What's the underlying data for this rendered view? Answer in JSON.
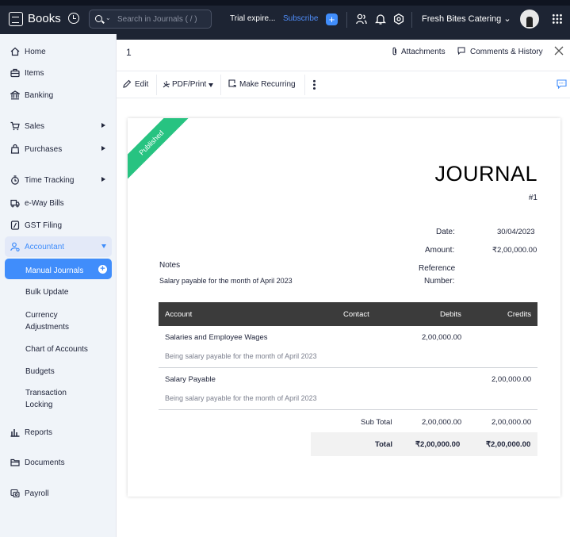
{
  "app": {
    "name": "Books",
    "search_placeholder": "Search in Journals ( / )",
    "trial_text": "Trial expire...",
    "subscribe_label": "Subscribe",
    "org_name": "Fresh Bites Catering",
    "accent": "#408dfb",
    "topbar_color": "#1d2433"
  },
  "sidebar": {
    "items": [
      {
        "label": "Home",
        "icon": "home-icon"
      },
      {
        "label": "Items",
        "icon": "items-icon"
      },
      {
        "label": "Banking",
        "icon": "bank-icon"
      },
      {
        "label": "Sales",
        "icon": "cart-icon"
      },
      {
        "label": "Purchases",
        "icon": "bag-icon"
      },
      {
        "label": "Time Tracking",
        "icon": "timer-icon"
      },
      {
        "label": "e-Way Bills",
        "icon": "truck-icon"
      },
      {
        "label": "GST Filing",
        "icon": "gst-icon"
      },
      {
        "label": "Accountant",
        "icon": "accountant-icon"
      },
      {
        "label": "Reports",
        "icon": "reports-icon"
      },
      {
        "label": "Documents",
        "icon": "folder-icon"
      },
      {
        "label": "Payroll",
        "icon": "payroll-icon"
      }
    ],
    "accountant_sub": [
      {
        "label": "Manual Journals"
      },
      {
        "label": "Bulk Update"
      },
      {
        "label": "Currency Adjustments"
      },
      {
        "label": "Chart of Accounts"
      },
      {
        "label": "Budgets"
      },
      {
        "label": "Transaction Locking"
      }
    ]
  },
  "header": {
    "doc_number": "1",
    "attachments_label": "Attachments",
    "comments_label": "Comments & History"
  },
  "toolbar": {
    "edit_label": "Edit",
    "pdf_label": "PDF/Print",
    "recurring_label": "Make Recurring"
  },
  "journal": {
    "ribbon": "Published",
    "title": "JOURNAL",
    "number": "#1",
    "date_label": "Date:",
    "date_value": "30/04/2023",
    "amount_label": "Amount:",
    "amount_value": "₹2,00,000.00",
    "ref_label_1": "Reference",
    "ref_label_2": "Number:",
    "notes_label": "Notes",
    "notes_text": "Salary payable for the month of April 2023",
    "columns": [
      "Account",
      "Contact",
      "Debits",
      "Credits"
    ],
    "rows": [
      {
        "account": "Salaries and Employee Wages",
        "description": "Being salary payable for the month of April 2023",
        "debit": "2,00,000.00",
        "credit": ""
      },
      {
        "account": "Salary Payable",
        "description": "Being salary payable for the month of April 2023",
        "debit": "",
        "credit": "2,00,000.00"
      }
    ],
    "subtotal_label": "Sub Total",
    "subtotal_debit": "2,00,000.00",
    "subtotal_credit": "2,00,000.00",
    "total_label": "Total",
    "total_debit": "₹2,00,000.00",
    "total_credit": "₹2,00,000.00",
    "ribbon_color": "#27c381"
  }
}
